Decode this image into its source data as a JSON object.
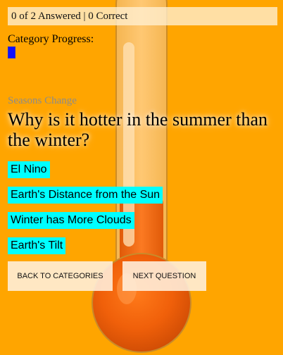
{
  "status": {
    "text": "0 of 2 Answered | 0 Correct"
  },
  "category": {
    "label": "Category Progress:",
    "progress_fraction": 0.0,
    "bar_color": "#1010ff"
  },
  "quiz": {
    "subject": "Seasons Change",
    "question": "Why is it hotter in the summer than the winter?",
    "answers": [
      {
        "label": "El Nino"
      },
      {
        "label": "Earth's Distance from the Sun"
      },
      {
        "label": "Winter has More Clouds"
      },
      {
        "label": "Earth's Tilt"
      }
    ]
  },
  "buttons": {
    "back_label": "BACK TO CATEGORIES",
    "next_label": "NEXT QUESTION"
  },
  "colors": {
    "background": "#FFA500",
    "answer_bg": "#00FFFF",
    "thermometer": "#F56A0C"
  },
  "background_illustration": "thermometer"
}
